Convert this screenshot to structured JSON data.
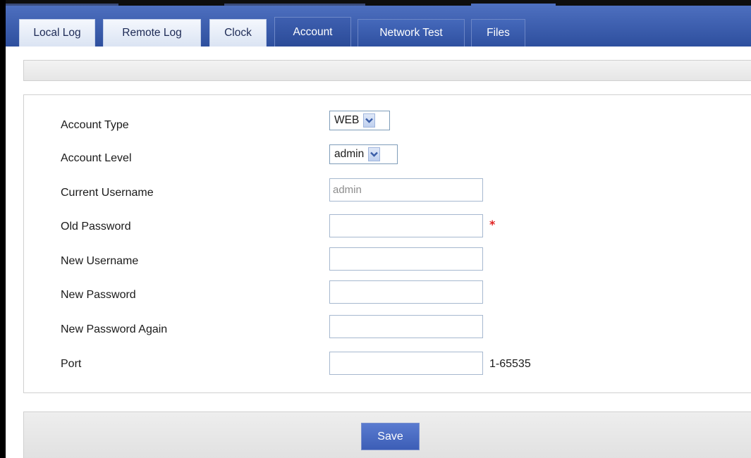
{
  "tabs": [
    {
      "label": "Local Log"
    },
    {
      "label": "Remote Log"
    },
    {
      "label": "Clock"
    },
    {
      "label": "Account",
      "active": true
    },
    {
      "label": "Network Test"
    },
    {
      "label": "Files"
    }
  ],
  "form": {
    "account_type": {
      "label": "Account Type",
      "value": "WEB"
    },
    "account_level": {
      "label": "Account Level",
      "value": "admin"
    },
    "current_username": {
      "label": "Current Username",
      "value": "admin"
    },
    "old_password": {
      "label": "Old Password",
      "value": "",
      "required_mark": "*"
    },
    "new_username": {
      "label": "New Username",
      "value": ""
    },
    "new_password": {
      "label": "New Password",
      "value": ""
    },
    "new_password_again": {
      "label": "New Password Again",
      "value": ""
    },
    "port": {
      "label": "Port",
      "value": "",
      "hint": "1-65535"
    }
  },
  "actions": {
    "save_label": "Save"
  },
  "icons": {
    "dropdown": "chevron-down-icon"
  },
  "colors": {
    "tabbar": "#2e4f9e",
    "accent": "#3c5eb6",
    "required": "#e02020"
  }
}
